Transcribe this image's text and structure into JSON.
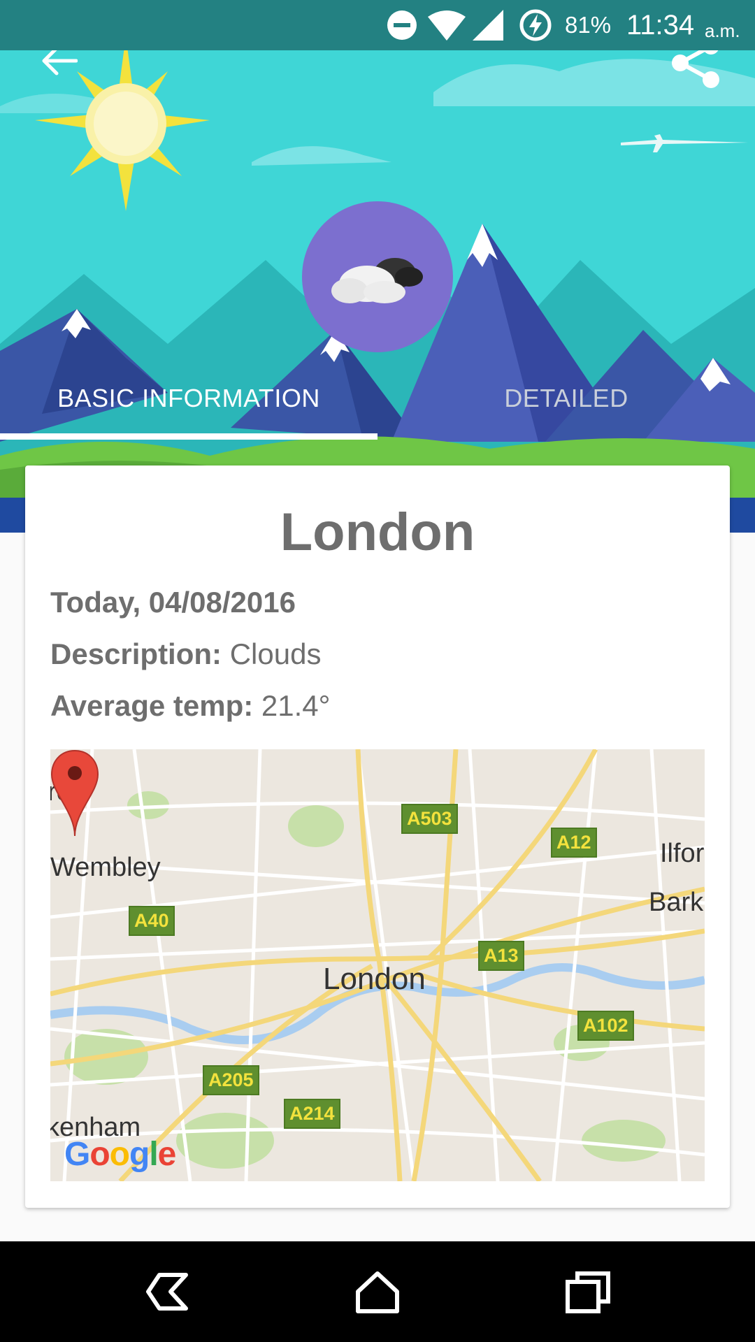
{
  "status_bar": {
    "battery": "81%",
    "time": "11:34",
    "ampm": "a.m."
  },
  "tabs": {
    "basic": "BASIC INFORMATION",
    "detailed": "DETAILED"
  },
  "card": {
    "city": "London",
    "date": "Today, 04/08/2016",
    "description_label": "Description:",
    "description_value": " Clouds",
    "temp_label": "Average temp:",
    "temp_value": " 21.4°"
  },
  "map": {
    "labels": {
      "row": "row",
      "wembley": "Wembley",
      "london": "London",
      "ilford": "Ilfor",
      "barking": "Barki",
      "kenham": "kenham"
    },
    "roads": {
      "a503": "A503",
      "a12": "A12",
      "a40": "A40",
      "a13": "A13",
      "a102": "A102",
      "a205": "A205",
      "a214": "A214"
    },
    "logo": "Google"
  },
  "icons": {
    "back": "arrow-back-icon",
    "share": "share-icon",
    "weather": "clouds-icon",
    "dnd": "do-not-disturb-icon",
    "wifi": "wifi-icon",
    "signal": "cell-signal-icon",
    "battery": "battery-charging-icon"
  },
  "colors": {
    "status_bar": "#238182",
    "sky": "#3fd6d6",
    "avatar": "#7c6fcf",
    "text": "#6e6e6e"
  }
}
